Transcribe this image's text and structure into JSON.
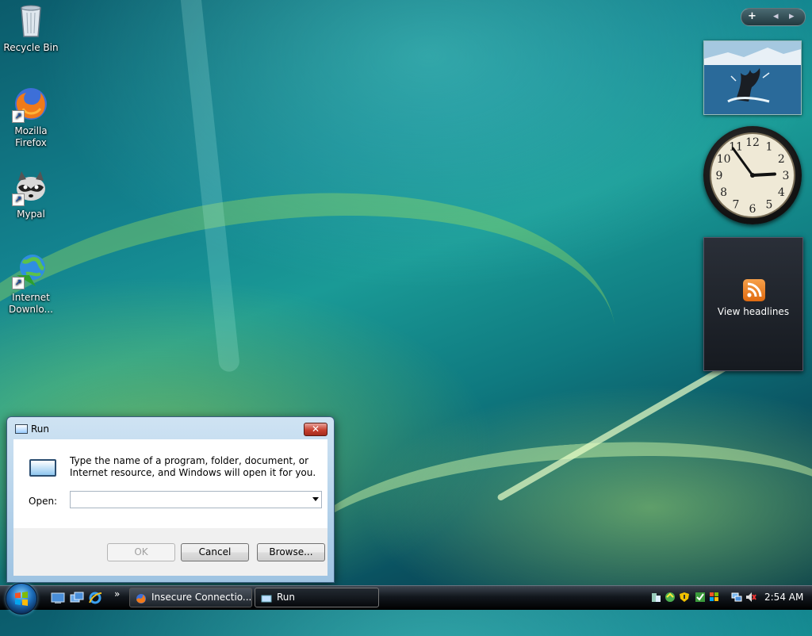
{
  "desktop": {
    "icons": [
      {
        "label": "Recycle Bin"
      },
      {
        "label": "Mozilla Firefox"
      },
      {
        "label": "Mypal"
      },
      {
        "label": "Internet Downlo..."
      }
    ]
  },
  "gadgets": {
    "toolbar": {
      "add_glyph": "+",
      "prev_glyph": "◂",
      "next_glyph": "▸"
    },
    "clock": {
      "numerals": [
        "12",
        "1",
        "2",
        "3",
        "4",
        "5",
        "6",
        "7",
        "8",
        "9",
        "10",
        "11"
      ],
      "hour": 2,
      "minute": 54
    },
    "feed": {
      "label": "View headlines"
    }
  },
  "run_dialog": {
    "title": "Run",
    "close_glyph": "✕",
    "description": "Type the name of a program, folder, document, or Internet resource, and Windows will open it for you.",
    "open_label": "Open:",
    "open_value": "",
    "buttons": {
      "ok": "OK",
      "cancel": "Cancel",
      "browse": "Browse..."
    }
  },
  "taskbar": {
    "ql_more": "»",
    "tasks": [
      {
        "label": "Insecure Connectio...",
        "active": false
      },
      {
        "label": "Run",
        "active": true
      }
    ],
    "clock": "2:54 AM"
  },
  "colors": {
    "accent": "#1b6bb8",
    "close_red": "#c7402f",
    "rss_orange": "#e06a10"
  }
}
